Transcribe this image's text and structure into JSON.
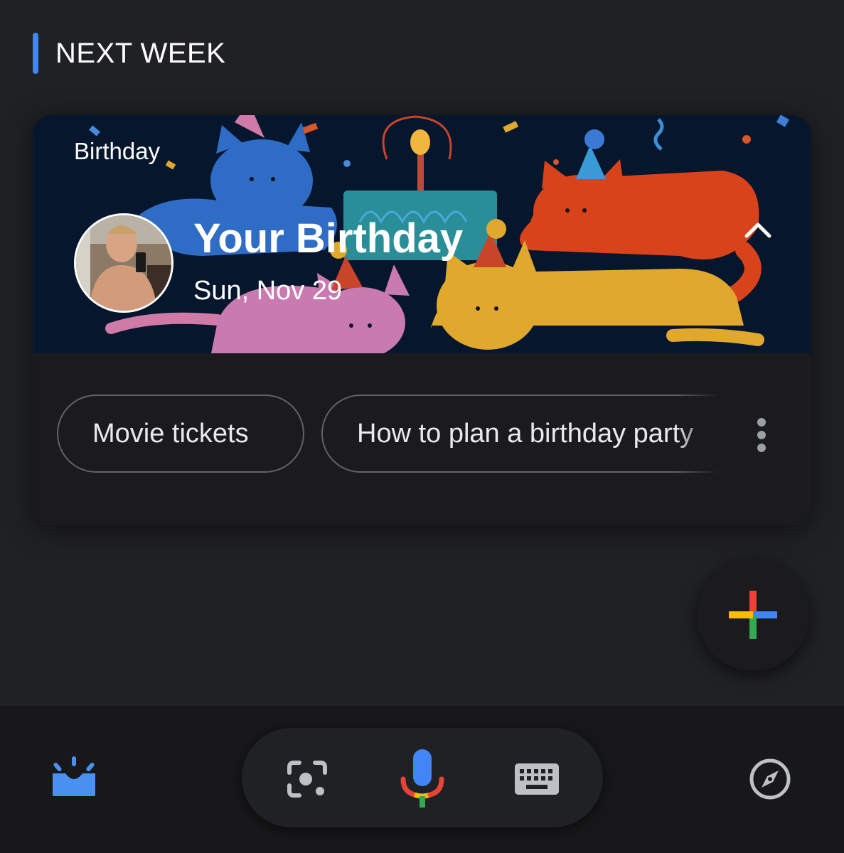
{
  "section": {
    "title": "NEXT WEEK",
    "accent_color": "#4285f4"
  },
  "card": {
    "label": "Birthday",
    "title": "Your Birthday",
    "date": "Sun, Nov 29",
    "collapse_icon": "chevron-up-icon",
    "chips": [
      {
        "label": "Movie tickets"
      },
      {
        "label": "How to plan a birthday party"
      }
    ],
    "more_icon": "more-vert-icon"
  },
  "fab": {
    "icon": "plus-icon",
    "colors": [
      "#ea4335",
      "#4285f4",
      "#34a853",
      "#fbbc05"
    ]
  },
  "bottom_nav": {
    "updates_icon": "updates-icon",
    "lens_icon": "lens-icon",
    "mic_icon": "mic-icon",
    "keyboard_icon": "keyboard-icon",
    "explore_icon": "compass-icon"
  }
}
